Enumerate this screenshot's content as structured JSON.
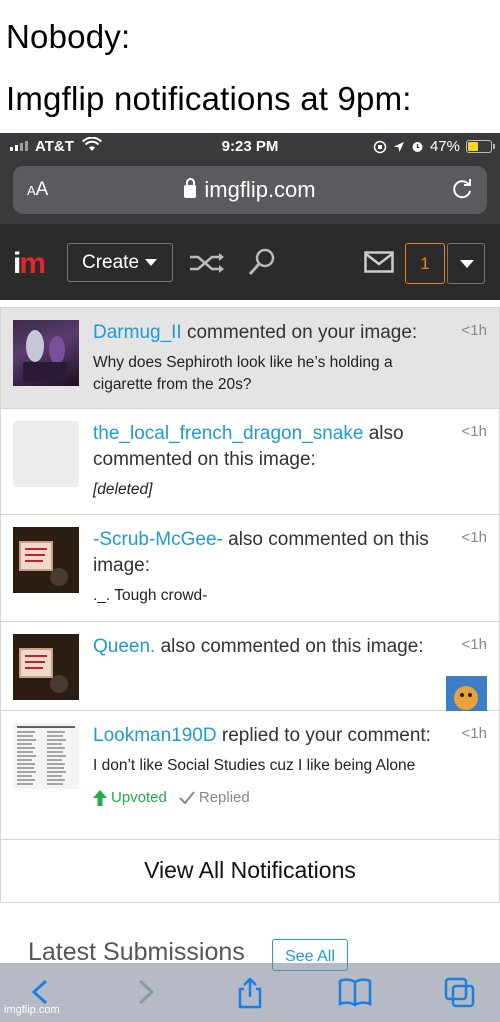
{
  "caption": {
    "line1": "Nobody:",
    "line2": "Imgflip notifications at 9pm:"
  },
  "statusbar": {
    "carrier": "AT&T",
    "time": "9:23 PM",
    "battery": "47%",
    "battery_level": 0.47,
    "battery_color": "#f5d327"
  },
  "urlbar": {
    "text_size_label": "AA",
    "url": "imgflip.com"
  },
  "nav": {
    "logo_i": "i",
    "logo_m": "m",
    "create_label": "Create",
    "notif_count": "1",
    "accent": "#e8841a",
    "brand_red": "#e8262a"
  },
  "notifications": [
    {
      "user": "Darmug_II",
      "action": " commented on your image:",
      "body": "Why does Sephiroth look like he’s holding a cigarette from the 20s?",
      "time": "<1h"
    },
    {
      "user": "the_local_french_dragon_snake",
      "action": " also commented on this image:",
      "body": "[deleted]",
      "time": "<1h"
    },
    {
      "user": "-Scrub-McGee-",
      "action": " also commented on this image:",
      "body": "._. Tough crowd-",
      "time": "<1h"
    },
    {
      "user": "Queen.",
      "action": " also commented on this image:",
      "body": "",
      "time": "<1h"
    },
    {
      "user": "Lookman190D",
      "action": " replied to your comment:",
      "body": "I don’t like Social Studies cuz I like being Alone",
      "time": "<1h",
      "upvoted_label": "Upvoted",
      "replied_label": "Replied"
    }
  ],
  "view_all_label": "View All Notifications",
  "latest": {
    "title": "Latest Submissions",
    "see_all": "See All"
  },
  "watermark": "imgflip.com",
  "link_color": "#1e9ad6"
}
